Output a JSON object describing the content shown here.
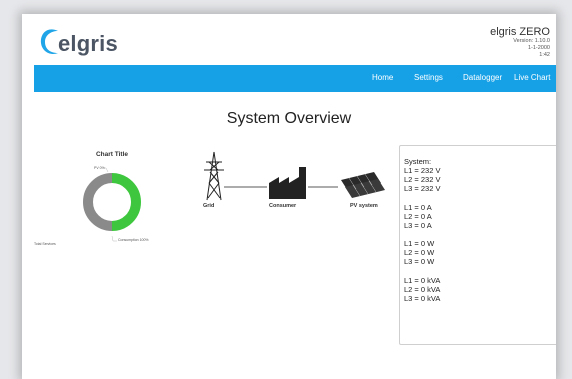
{
  "header": {
    "logo_text": "elgris",
    "brand_name": "elgris ZERO",
    "version": "Version: 1.10.0",
    "date": "1-1-2000",
    "time": "1:42"
  },
  "nav": {
    "items": [
      "Home",
      "Settings",
      "Datalogger",
      "Live Chart"
    ]
  },
  "page": {
    "title": "System Overview"
  },
  "chart": {
    "title": "Chart Title",
    "label_top": "PV 0%",
    "label_bottom": "Consumption 100%",
    "label_left": "Total Services",
    "colors": {
      "green": "#3ec73e",
      "gray": "#8a8a8a"
    }
  },
  "chart_data": {
    "type": "pie",
    "title": "Chart Title",
    "categories": [
      "PV",
      "Consumption"
    ],
    "values": [
      50,
      50
    ]
  },
  "diagram": {
    "grid_label": "Grid",
    "consumer_label": "Consumer",
    "pv_label": "PV system"
  },
  "system": {
    "heading": "System:",
    "voltage": [
      "L1 = 232 V",
      "L2 = 232 V",
      "L3 = 232 V"
    ],
    "current": [
      "L1 = 0 A",
      "L2 = 0 A",
      "L3 = 0 A"
    ],
    "power": [
      "L1 = 0 W",
      "L2 = 0 W",
      "L3 = 0 W"
    ],
    "apparent": [
      "L1 = 0 kVA",
      "L2 = 0 kVA",
      "L3 = 0 kVA"
    ]
  }
}
